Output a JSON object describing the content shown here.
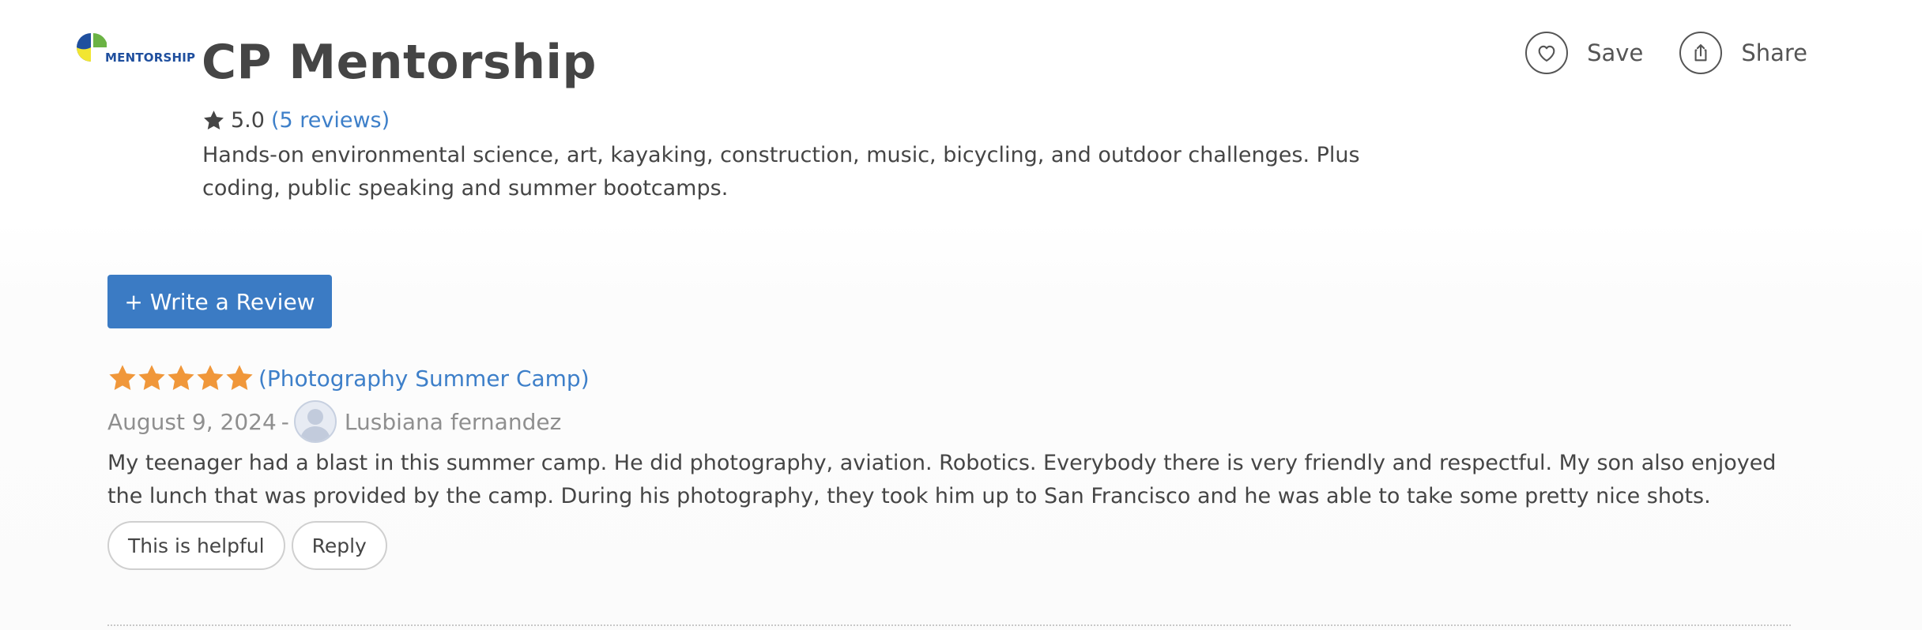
{
  "org": {
    "logo_text": "MENTORSHIP",
    "name": "CP Mentorship",
    "rating": "5.0",
    "reviews_link": "(5 reviews)",
    "description": "Hands-on environmental science, art, kayaking, construction, music, bicycling, and outdoor challenges. Plus coding, public speaking and summer bootcamps."
  },
  "actions": {
    "save_label": "Save",
    "share_label": "Share"
  },
  "write_review_label": "+ Write a Review",
  "review": {
    "stars": 5,
    "camp": "(Photography Summer Camp)",
    "date": "August 9, 2024",
    "separator": "-",
    "author": "Lusbiana fernandez",
    "text": "My teenager had a blast in this summer camp. He did photography, aviation. Robotics. Everybody there is very friendly and respectful. My son also enjoyed the lunch that was provided by the camp. During his photography, they took him up to San Francisco and he was able to take some pretty nice shots.",
    "helpful_label": "This is helpful",
    "reply_label": "Reply"
  },
  "colors": {
    "accent": "#3b7bc4",
    "link": "#3d7fc9",
    "star": "#f0973a",
    "text": "#454545",
    "muted": "#8f8f8f"
  },
  "icons": {
    "rating": "star-icon",
    "save": "heart-icon",
    "share": "share-icon",
    "avatar": "user-avatar-icon"
  }
}
